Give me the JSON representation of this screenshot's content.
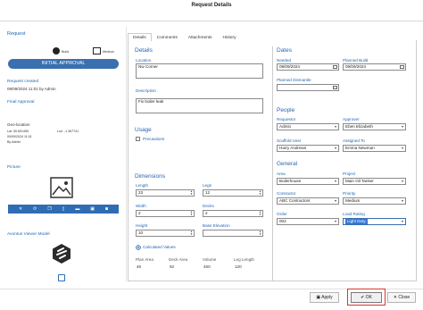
{
  "window": {
    "title": "Request Details"
  },
  "left": {
    "request_title": "Request",
    "build_label": "Build",
    "medium_label": "Medium",
    "status": "INITIAL APPROVAL",
    "request_created_label": "Request created",
    "request_created_value": "09/09/2024 11:01 by Admin",
    "final_approval_label": "Final Approval",
    "geo_label": "Geo-location",
    "lat": "Lat. 50.831459",
    "lon": "Lon. -1.367741",
    "geo_time": "09/09/2024 11:01",
    "geo_by": "By Admin",
    "picture_label": "Picture",
    "picture_toolbar_icons": [
      "close-icon",
      "rotate-icon",
      "copy-icon",
      "delete-icon",
      "folder-icon",
      "image-icon",
      "camera-icon"
    ],
    "viewer_label": "Avontus Viewer Model"
  },
  "tabs": [
    "Details",
    "Comments",
    "Attachments",
    "History"
  ],
  "details": {
    "heading": "Details",
    "location_label": "Location",
    "location_value": "Nw Corner",
    "description_label": "Description",
    "description_value": "Fix boiler leak",
    "usage_heading": "Usage",
    "precautions_label": "Precautions",
    "precautions_checked": false,
    "dimensions_heading": "Dimensions",
    "length_label": "Length",
    "length_value": "23",
    "legs_label": "Legs",
    "legs_value": "12",
    "width_label": "Width",
    "width_value": "2",
    "decks_label": "Decks",
    "decks_value": "2",
    "height_label": "Height",
    "height_value": "10",
    "base_elevation_label": "Base Elevation",
    "base_elevation_value": "",
    "calculated_values_label": "Calculated Values",
    "plan_area_label": "Plan Area",
    "plan_area_value": "46",
    "deck_area_label": "Deck Area",
    "deck_area_value": "92",
    "volume_label": "Volume",
    "volume_value": "460",
    "leg_length_label": "Leg Length",
    "leg_length_value": "120"
  },
  "dates": {
    "heading": "Dates",
    "needed_label": "Needed",
    "needed_value": "09/09/2024",
    "planned_build_label": "Planned Build",
    "planned_build_value": "09/09/2024",
    "planned_dismantle_label": "Planned Dismantle",
    "planned_dismantle_value": ""
  },
  "people": {
    "heading": "People",
    "requestor_label": "Requestor",
    "requestor_value": "Admin",
    "approver_label": "Approver",
    "approver_value": "Eben Elizabeth",
    "scaffold_user_label": "Scaffold User",
    "scaffold_user_value": "Harry Andrews",
    "assigned_to_label": "Assigned To",
    "assigned_to_value": "Emma Newman"
  },
  "general": {
    "heading": "General",
    "area_label": "Area",
    "area_value": "Boilerhouse",
    "project_label": "Project",
    "project_value": "Main Oil Tanker",
    "contractor_label": "Contractor",
    "contractor_value": "ABC Contractors",
    "priority_label": "Priority",
    "priority_value": "Medium",
    "order_label": "Order",
    "order_value": "002",
    "load_rating_label": "Load Rating",
    "load_rating_value": "Light Duty"
  },
  "footer": {
    "apply_label": "Apply",
    "ok_label": "OK",
    "close_label": "Close"
  },
  "colors": {
    "accent": "#2e6db4",
    "status_bar": "#3a6fb0",
    "highlight": "#d9352c"
  }
}
